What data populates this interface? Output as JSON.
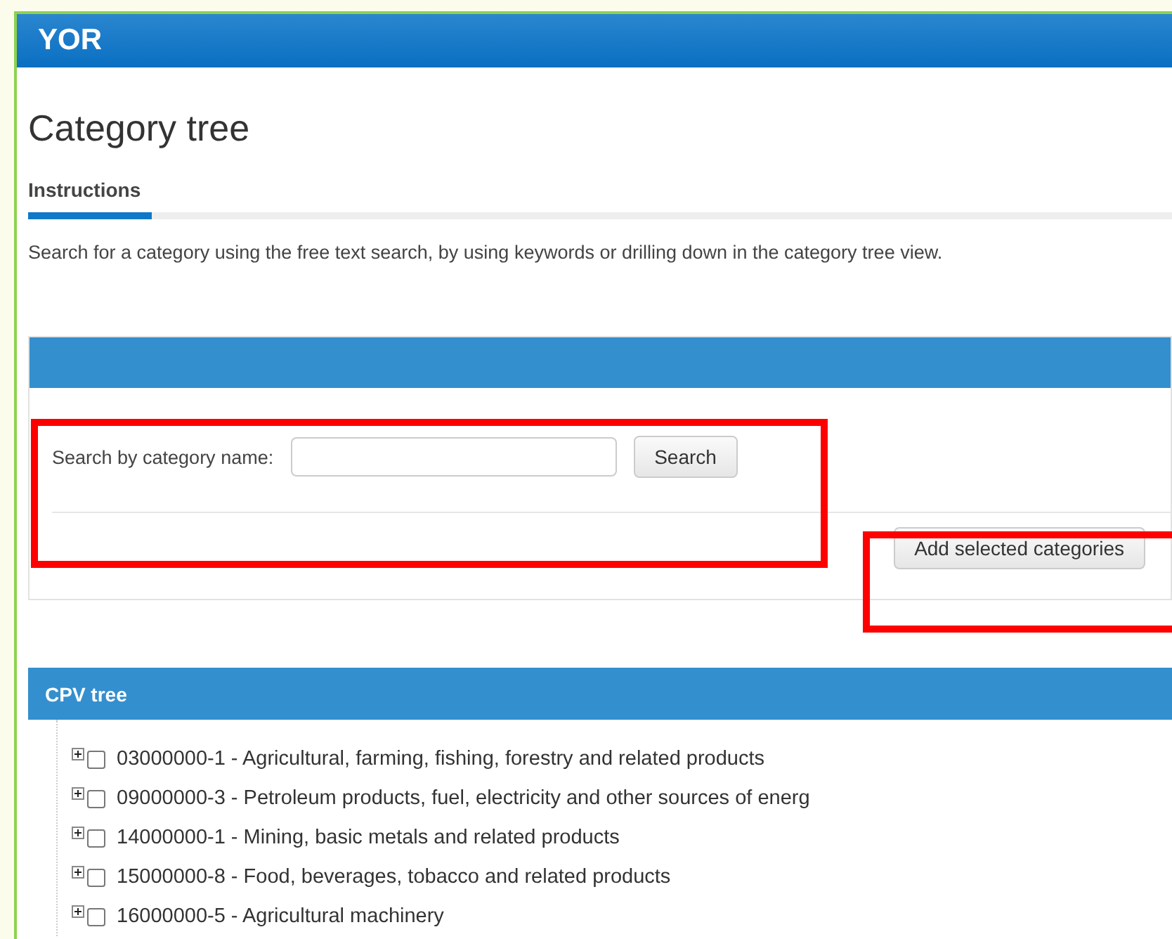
{
  "header": {
    "title": "YOR"
  },
  "page": {
    "title": "Category tree"
  },
  "tabs": [
    {
      "label": "Instructions",
      "selected": true
    }
  ],
  "instructions": "Search for a category using the free text search, by using keywords or drilling down in the category tree view.",
  "search_panel": {
    "label": "Search by category name:",
    "search_button": "Search",
    "add_button": "Add selected categories"
  },
  "tree": {
    "title": "CPV tree",
    "items": [
      {
        "label": "03000000-1 - Agricultural, farming, fishing, forestry and related products",
        "expanded": false,
        "checked": false
      },
      {
        "label": "09000000-3 - Petroleum products, fuel, electricity and other sources of energ",
        "expanded": false,
        "checked": false
      },
      {
        "label": "14000000-1 - Mining, basic metals and related products",
        "expanded": false,
        "checked": false
      },
      {
        "label": "15000000-8 - Food, beverages, tobacco and related products",
        "expanded": false,
        "checked": false
      },
      {
        "label": "16000000-5 - Agricultural machinery",
        "expanded": false,
        "checked": false
      }
    ]
  }
}
